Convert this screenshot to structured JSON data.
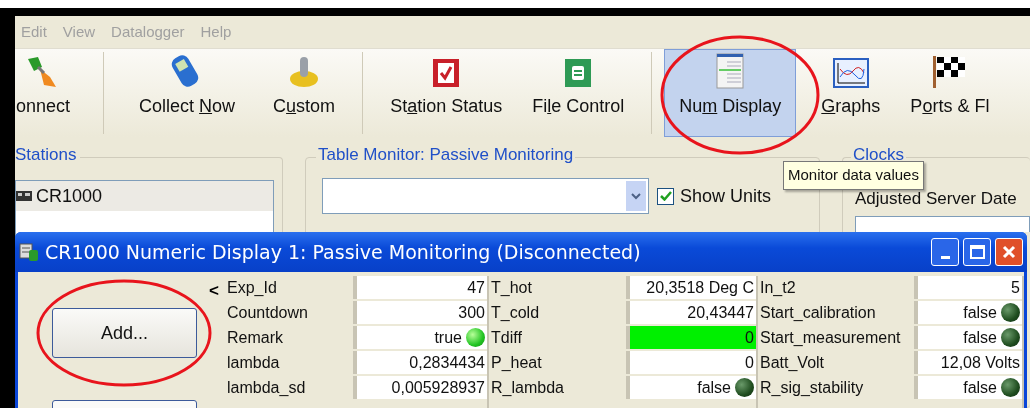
{
  "menu": [
    "Edit",
    "View",
    "Datalogger",
    "Help"
  ],
  "toolbar": [
    {
      "before": "onnect",
      "kind": "plug",
      "selected": false
    },
    {
      "before": "Collect ",
      "key": "N",
      "after": "ow",
      "kind": "phone",
      "selected": false
    },
    {
      "before": "C",
      "key": "u",
      "after": "stom",
      "kind": "gear",
      "selected": false
    },
    {
      "before": "St",
      "key": "a",
      "after": "tion Status",
      "kind": "status",
      "selected": false
    },
    {
      "before": "Fi",
      "key": "l",
      "after": "e Control",
      "kind": "file",
      "selected": false
    },
    {
      "before": "Nu",
      "key": "m",
      "after": " Display",
      "kind": "table",
      "selected": true
    },
    {
      "key": "G",
      "after": "raphs",
      "kind": "graph",
      "selected": false
    },
    {
      "before": "P",
      "key": "o",
      "after": "rts & Fl",
      "kind": "flag",
      "selected": false
    }
  ],
  "stations": {
    "title": "Stations",
    "items": [
      {
        "label": "CR1000",
        "selected": true
      }
    ]
  },
  "table_monitor": {
    "title": "Table Monitor: Passive Monitoring",
    "show_units": {
      "label": "Show Units",
      "checked": true
    }
  },
  "clocks": {
    "title": "Clocks",
    "label": "Adjusted Server Date"
  },
  "tooltip": "Monitor data values",
  "numeric_window": {
    "title": "CR1000 Numeric Display 1: Passive Monitoring (Disconnected)",
    "collapse": "<",
    "add_button": "Add...",
    "columns": [
      [
        {
          "name": "Exp_Id",
          "value": "47",
          "highlighted": false
        },
        {
          "name": "Countdown",
          "value": "300",
          "highlighted": false
        },
        {
          "name": "Remark",
          "value": "true",
          "kind": "lamp",
          "lit": true,
          "highlighted": false
        },
        {
          "name": "lambda",
          "value": "0,2834434",
          "highlighted": false
        },
        {
          "name": "lambda_sd",
          "value": "0,005928937",
          "highlighted": false
        }
      ],
      [
        {
          "name": "T_hot",
          "value": "20,3518 Deg C",
          "highlighted": false
        },
        {
          "name": "T_cold",
          "value": "20,43447",
          "highlighted": false
        },
        {
          "name": "Tdiff",
          "value": "0",
          "highlighted": true
        },
        {
          "name": "P_heat",
          "value": "0",
          "highlighted": false
        },
        {
          "name": "R_lambda",
          "value": "false",
          "kind": "lamp",
          "lit": false,
          "highlighted": false
        }
      ],
      [
        {
          "name": "In_t2",
          "value": "5",
          "highlighted": false
        },
        {
          "name": "Start_calibration",
          "value": "false",
          "kind": "lamp",
          "lit": false,
          "highlighted": false
        },
        {
          "name": "Start_measurement",
          "value": "false",
          "kind": "lamp",
          "lit": false,
          "highlighted": false
        },
        {
          "name": "Batt_Volt",
          "value": "12,08 Volts",
          "highlighted": false
        },
        {
          "name": "R_sig_stability",
          "value": "false",
          "kind": "lamp",
          "lit": false,
          "highlighted": false
        }
      ]
    ]
  }
}
